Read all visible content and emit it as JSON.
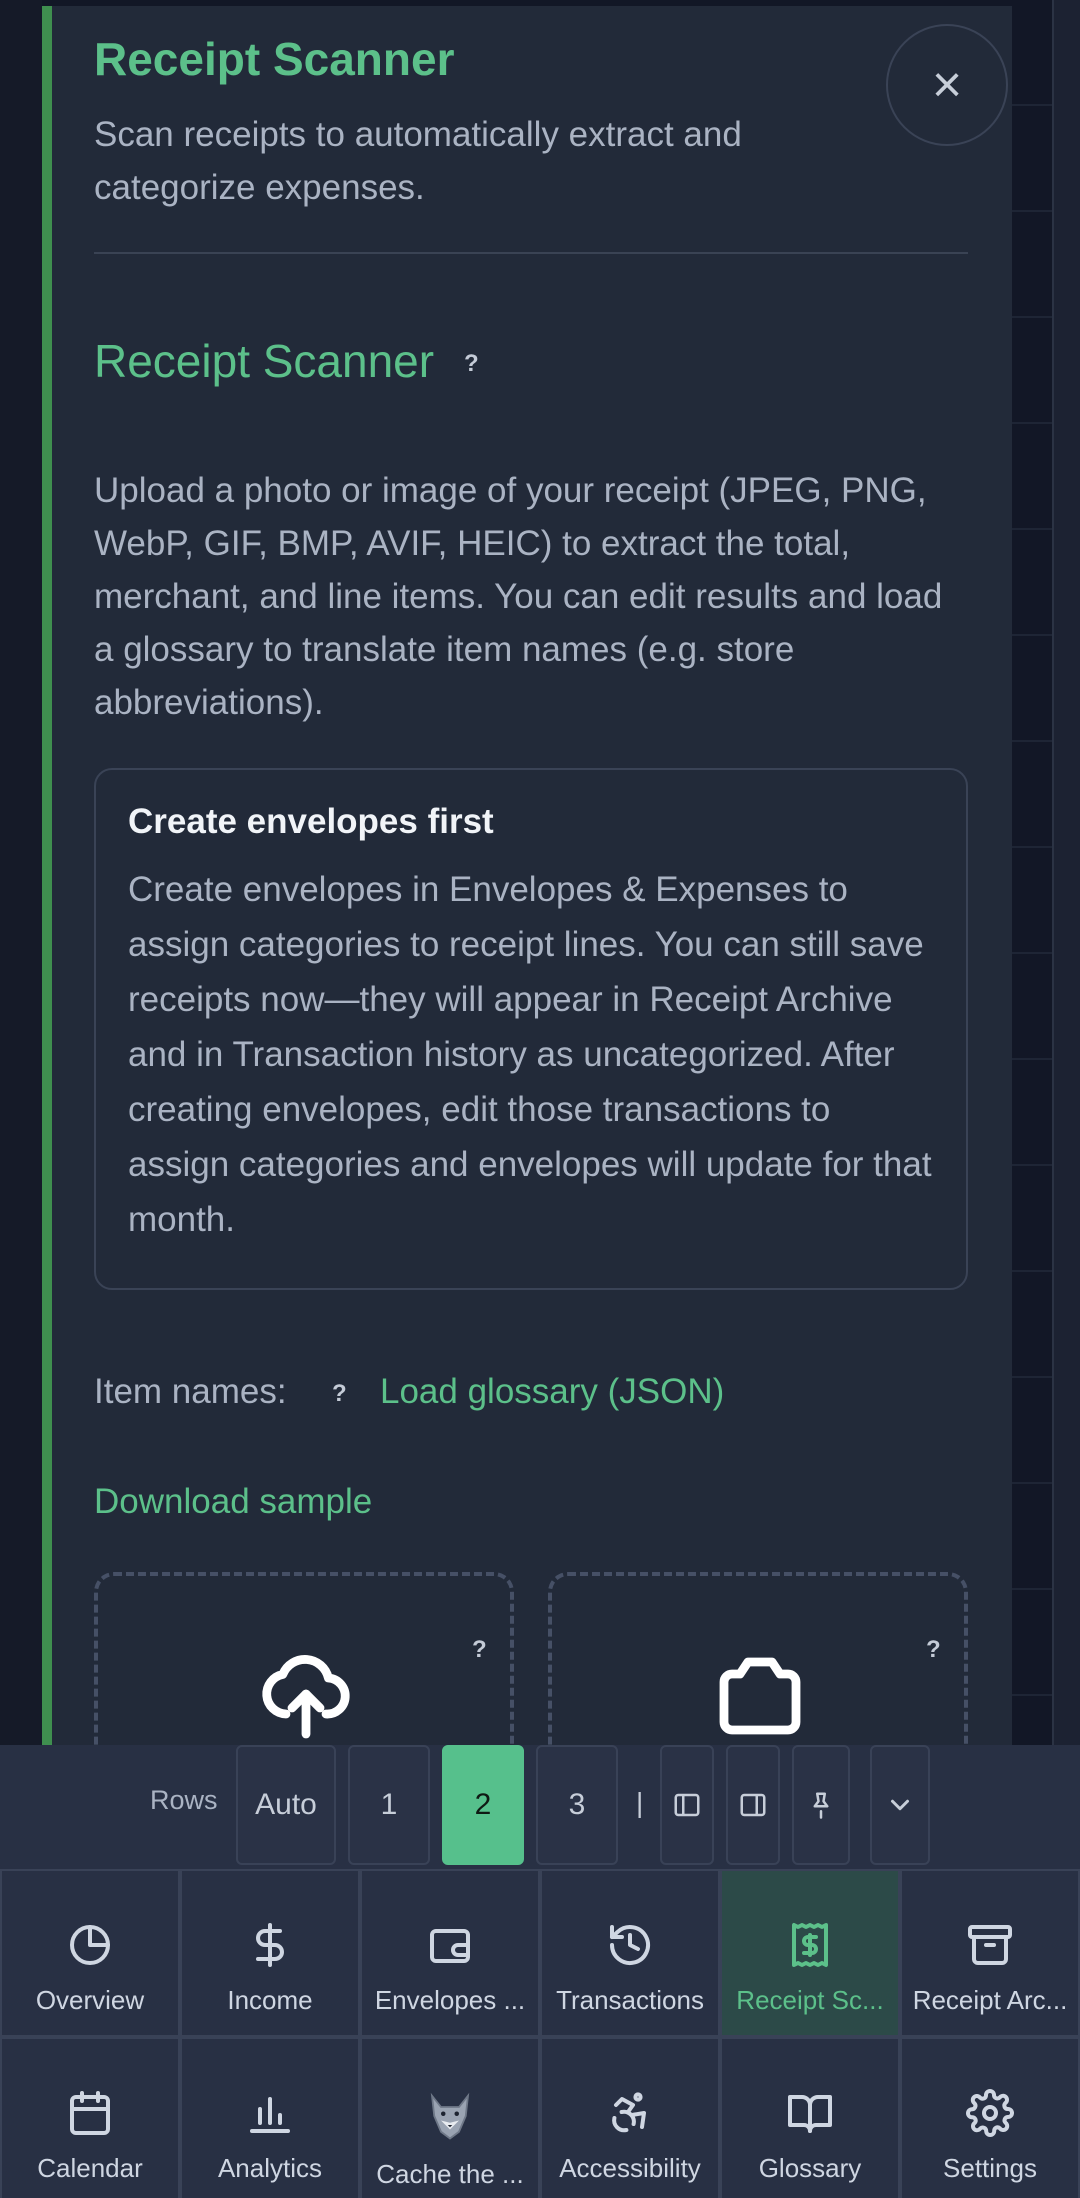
{
  "dialog": {
    "title": "Receipt Scanner",
    "subtitle": "Scan receipts to automatically extract and categorize expenses.",
    "close_label": "×"
  },
  "section": {
    "title": "Receipt Scanner",
    "help": "?",
    "description": "Upload a photo or image of your receipt (JPEG, PNG, WebP, GIF, BMP, AVIF, HEIC) to extract the total, merchant, and line items. You can edit results and load a glossary to translate item names (e.g. store abbreviations)."
  },
  "notice": {
    "title": "Create envelopes first",
    "body": "Create envelopes in Envelopes & Expenses to assign categories to receipt lines. You can still save receipts now—they will appear in Receipt Archive and in Transaction history as uncategorized. After creating envelopes, edit those transactions to assign categories and envelopes will update for that month."
  },
  "glossary": {
    "item_names_label": "Item names:",
    "help": "?",
    "load_link": "Load glossary (JSON)",
    "download_link": "Download sample"
  },
  "upload": {
    "upload_help": "?",
    "camera_help": "?"
  },
  "rows_bar": {
    "label": "Rows",
    "options": [
      "Auto",
      "1",
      "2",
      "3"
    ],
    "selected": "2",
    "separator": "|"
  },
  "nav": {
    "items": [
      {
        "label": "Overview",
        "icon": "pie-chart-icon"
      },
      {
        "label": "Income",
        "icon": "dollar-icon"
      },
      {
        "label": "Envelopes ...",
        "icon": "wallet-icon"
      },
      {
        "label": "Transactions",
        "icon": "history-icon"
      },
      {
        "label": "Receipt Sc...",
        "icon": "receipt-icon",
        "active": true
      },
      {
        "label": "Receipt Arc...",
        "icon": "archive-icon"
      },
      {
        "label": "Calendar",
        "icon": "calendar-icon"
      },
      {
        "label": "Analytics",
        "icon": "bar-chart-icon"
      },
      {
        "label": "Cache the ...",
        "icon": "wolf-icon"
      },
      {
        "label": "Accessibility",
        "icon": "accessibility-icon"
      },
      {
        "label": "Glossary",
        "icon": "book-icon"
      },
      {
        "label": "Settings",
        "icon": "gear-icon"
      }
    ]
  },
  "colors": {
    "accent": "#5cc08a",
    "panel": "#222a39",
    "panel_border": "#3f8f4f"
  }
}
